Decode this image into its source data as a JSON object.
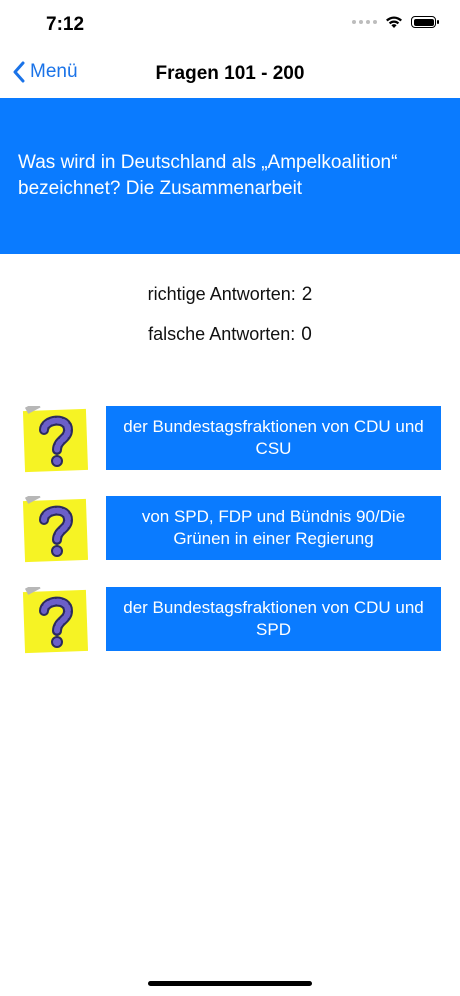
{
  "status_bar": {
    "time": "7:12"
  },
  "nav": {
    "back_label": "Menü",
    "title": "Fragen 101 - 200"
  },
  "question": {
    "text": "Was wird in Deutschland als „Ampelkoalition“ bezeichnet? Die Zusammenarbeit"
  },
  "score": {
    "correct_label": "richtige Antworten:",
    "correct_value": "2",
    "wrong_label": "falsche Antworten:",
    "wrong_value": "0"
  },
  "answers": [
    {
      "text": "der Bundestagsfraktionen von CDU und CSU",
      "icon": "question-mark-note-icon"
    },
    {
      "text": "von SPD, FDP und Bündnis 90/Die Grünen in einer Regierung",
      "icon": "question-mark-note-icon"
    },
    {
      "text": "der Bundestagsfraktionen von CDU und SPD",
      "icon": "question-mark-note-icon"
    }
  ],
  "colors": {
    "accent": "#0a7bff",
    "link": "#1a73e8",
    "note_yellow": "#f6f324",
    "note_pin": "#b7b7b7",
    "question_mark": "#6b5fc9"
  }
}
